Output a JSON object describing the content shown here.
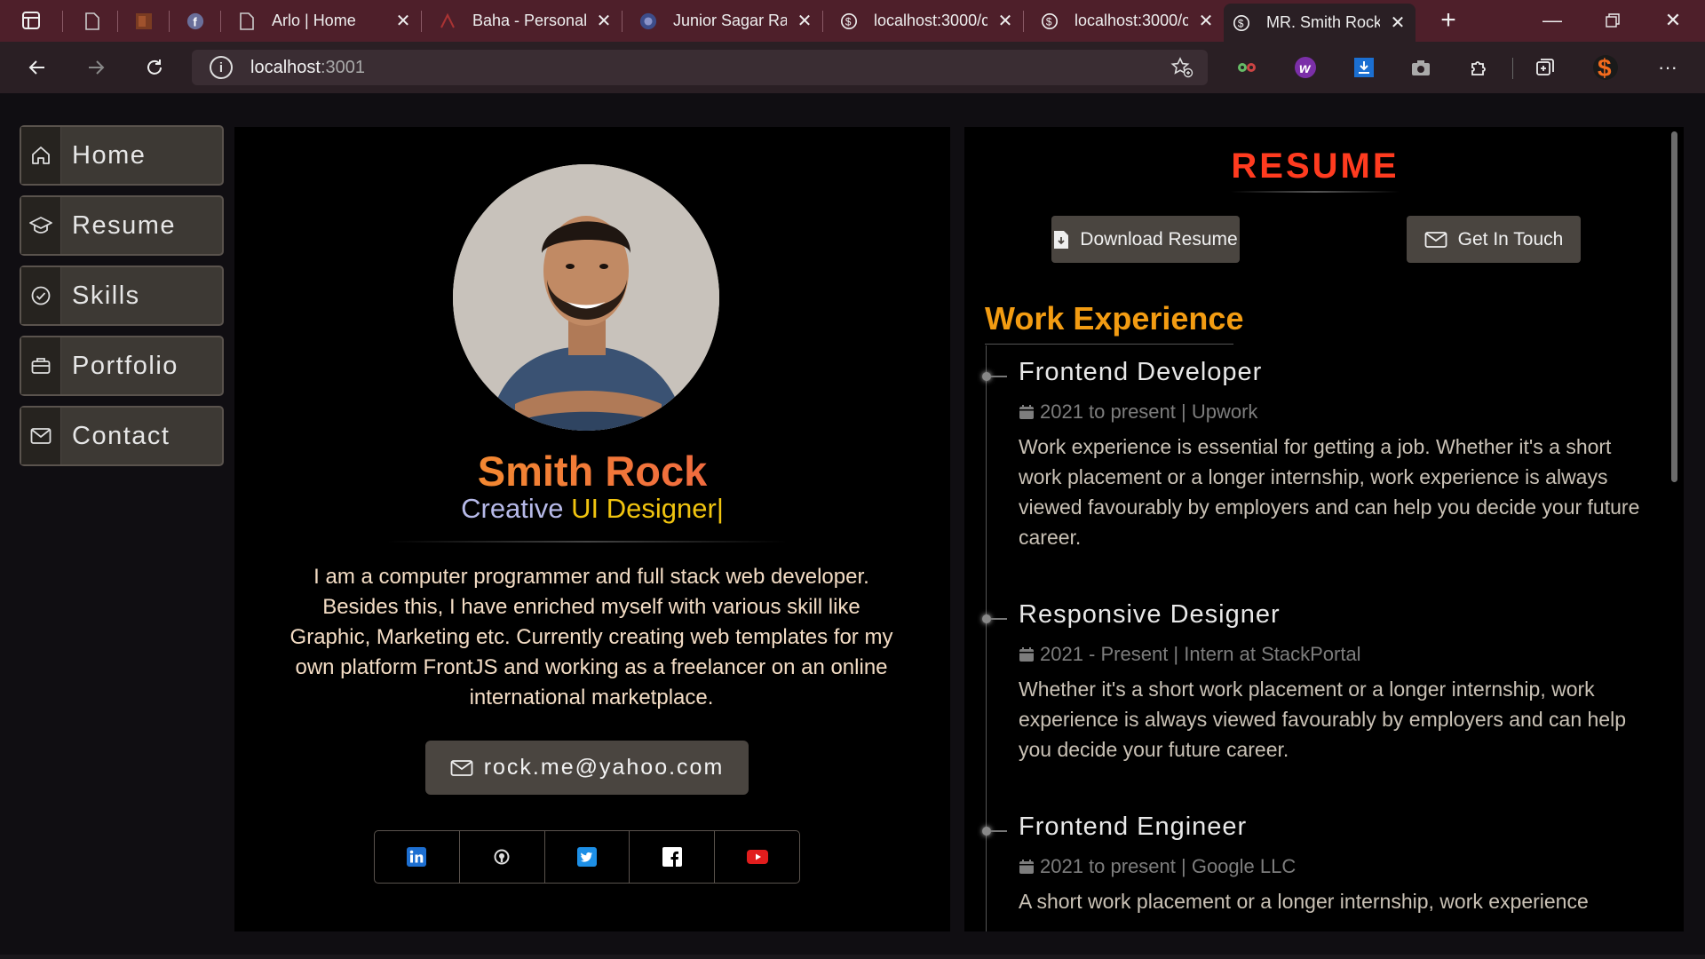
{
  "browser": {
    "tabs": [
      {
        "label": "",
        "icon": "page-icon"
      },
      {
        "label": "",
        "icon": "image-icon"
      },
      {
        "label": "",
        "icon": "facebook-icon"
      },
      {
        "label": "Arlo | Home",
        "icon": "page-icon"
      },
      {
        "label": "Baha - Personal",
        "icon": "page-icon"
      },
      {
        "label": "Junior Sagar Ray",
        "icon": "avatar-icon"
      },
      {
        "label": "localhost:3000/c",
        "icon": "globe-icon"
      },
      {
        "label": "localhost:3000/c",
        "icon": "globe-icon"
      },
      {
        "label": "MR. Smith Rock",
        "icon": "globe-icon"
      }
    ],
    "url_host": "localhost",
    "url_port": ":3001"
  },
  "sidebar": {
    "items": [
      {
        "label": "Home",
        "icon": "home-icon"
      },
      {
        "label": "Resume",
        "icon": "graduation-cap-icon"
      },
      {
        "label": "Skills",
        "icon": "check-circle-icon"
      },
      {
        "label": "Portfolio",
        "icon": "briefcase-icon"
      },
      {
        "label": "Contact",
        "icon": "envelope-icon"
      }
    ]
  },
  "profile": {
    "name": "Smith Rock",
    "role_prefix": "Creative ",
    "role_typed": "UI Designer|",
    "bio": "I am a computer programmer and full stack web developer. Besides this, I have enriched myself with various skill like Graphic, Marketing etc. Currently creating web templates for my own platform FrontJS and working as a freelancer on an online international marketplace.",
    "email": "rock.me@yahoo.com",
    "social": [
      "linkedin-icon",
      "github-icon",
      "twitter-icon",
      "facebook-icon",
      "youtube-icon"
    ]
  },
  "resume": {
    "title": "RESUME",
    "download_label": "Download Resume",
    "contact_label": "Get In Touch",
    "section_title": "Work Experience",
    "jobs": [
      {
        "title": "Frontend Developer",
        "meta": "2021 to present | Upwork",
        "desc": "Work experience is essential for getting a job. Whether it's a short work placement or a longer internship, work experience is always viewed favourably by employers and can help you decide your future career."
      },
      {
        "title": "Responsive Designer",
        "meta": "2021 - Present | Intern at StackPortal",
        "desc": "Whether it's a short work placement or a longer internship, work experience is always viewed favourably by employers and can help you decide your future career."
      },
      {
        "title": "Frontend Engineer",
        "meta": "2021 to present | Google LLC",
        "desc": "A short work placement or a longer internship, work experience"
      }
    ]
  },
  "colors": {
    "accent_orange": "#f39c12",
    "resume_red": "#ff3b1f",
    "tabbar": "#4e1f2a"
  }
}
